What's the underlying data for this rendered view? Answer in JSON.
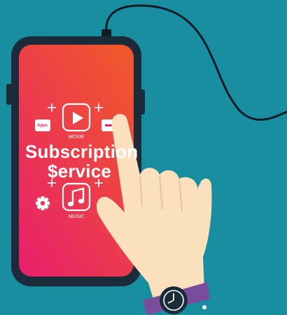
{
  "screen": {
    "title_line1": "Subscription",
    "title_line2": "$ervice",
    "movie_label": "MOVIE",
    "music_label": "MUSIC",
    "app_badge": "Apps"
  },
  "icons": [
    "play-icon",
    "music-note-icon",
    "gear-icon",
    "plus-icon",
    "apps-icon",
    "watch-icon"
  ],
  "colors": {
    "background": "#1a8ea1",
    "phone_body": "#1b2b3a",
    "screen_gradient_top": "#f0582c",
    "screen_gradient_bottom": "#e8226a",
    "hand_skin": "#fbe0bd",
    "watch_band": "#7a4d9c"
  }
}
